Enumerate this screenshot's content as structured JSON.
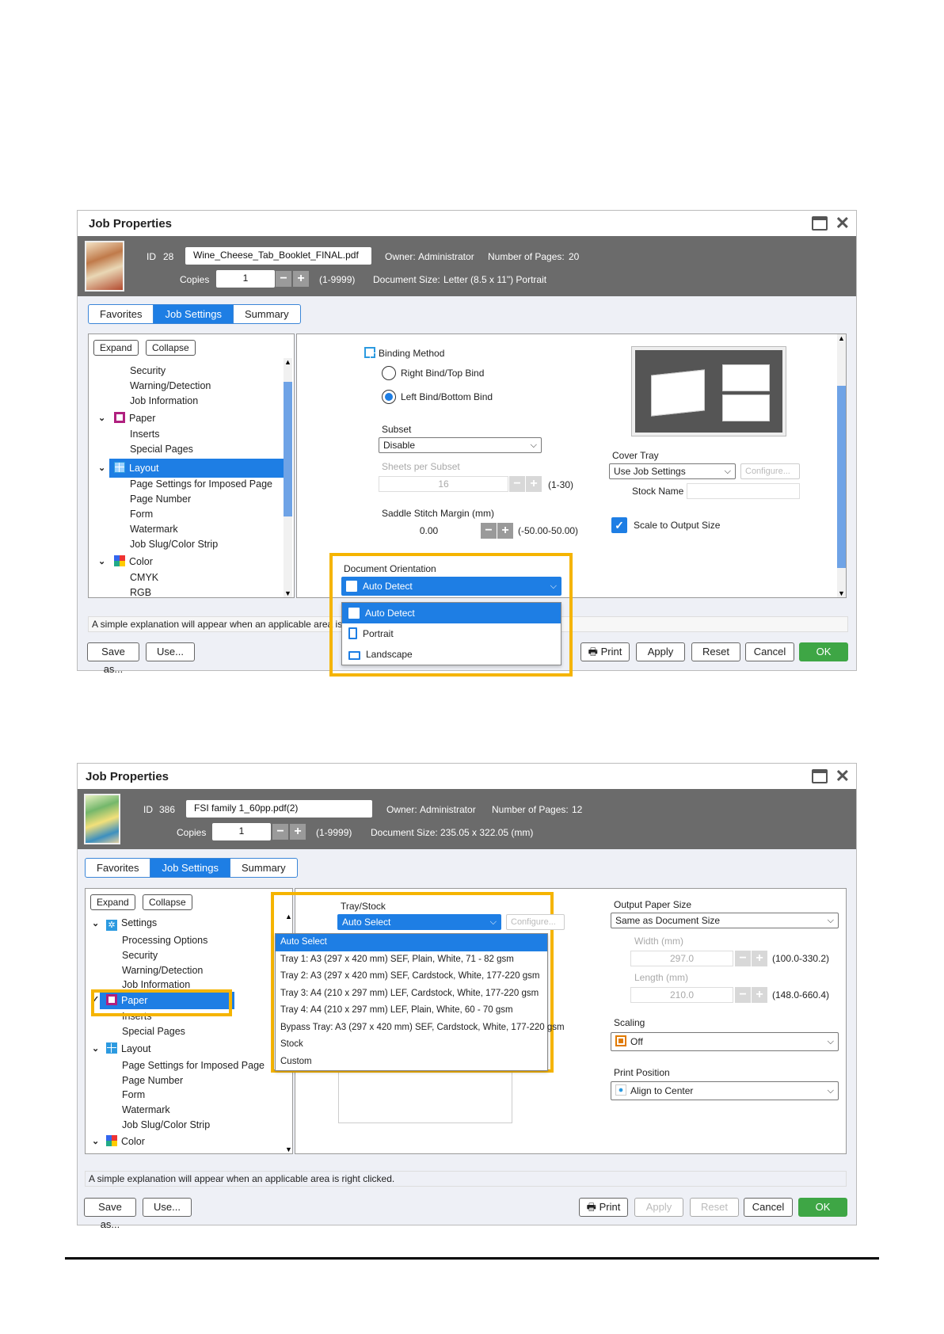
{
  "dialog1": {
    "title": "Job Properties",
    "header": {
      "id_label": "ID",
      "id_value": "28",
      "filename": "Wine_Cheese_Tab_Booklet_FINAL.pdf",
      "owner_label": "Owner:",
      "owner_value": "Administrator",
      "pages_label": "Number of Pages:",
      "pages_value": "20",
      "copies_label": "Copies",
      "copies_value": "1",
      "copies_range": "(1-9999)",
      "docsize_label": "Document Size:",
      "docsize_value": "Letter (8.5 x 11\") Portrait"
    },
    "tabs": [
      "Favorites",
      "Job Settings",
      "Summary"
    ],
    "expand": "Expand",
    "collapse": "Collapse",
    "tree": [
      "Security",
      "Warning/Detection",
      "Job Information",
      "Paper",
      "Inserts",
      "Special Pages",
      "Layout",
      "Page Settings for Imposed Page",
      "Page Number",
      "Form",
      "Watermark",
      "Job Slug/Color Strip",
      "Color",
      "CMYK",
      "RGB"
    ],
    "binding_method": "Binding Method",
    "right_bind": "Right Bind/Top Bind",
    "left_bind": "Left Bind/Bottom Bind",
    "subset_label": "Subset",
    "subset_value": "Disable",
    "sheets_label": "Sheets per Subset",
    "sheets_value": "16",
    "sheets_range": "(1-30)",
    "saddle_label": "Saddle Stitch Margin (mm)",
    "saddle_value": "0.00",
    "saddle_range": "(-50.00-50.00)",
    "cover_tray_label": "Cover Tray",
    "cover_tray_value": "Use Job Settings",
    "configure": "Configure...",
    "stock_name": "Stock Name",
    "scale_label": "Scale to Output Size",
    "orientation_label": "Document Orientation",
    "orientation_value": "Auto Detect",
    "orientation_options": [
      "Auto Detect",
      "Portrait",
      "Landscape"
    ],
    "explain": "A simple explanation will appear when an applicable area is rig",
    "save_as": "Save as...",
    "use": "Use...",
    "print": "Print",
    "apply": "Apply",
    "reset": "Reset",
    "cancel": "Cancel",
    "ok": "OK"
  },
  "dialog2": {
    "title": "Job Properties",
    "header": {
      "id_label": "ID",
      "id_value": "386",
      "filename": "FSI family 1_60pp.pdf(2)",
      "owner_label": "Owner:",
      "owner_value": "Administrator",
      "pages_label": "Number of Pages:",
      "pages_value": "12",
      "copies_label": "Copies",
      "copies_value": "1",
      "copies_range": "(1-9999)",
      "docsize_label": "Document Size:",
      "docsize_value": "235.05 x 322.05 (mm)"
    },
    "tabs": [
      "Favorites",
      "Job Settings",
      "Summary"
    ],
    "expand": "Expand",
    "collapse": "Collapse",
    "tree": [
      "Settings",
      "Processing Options",
      "Security",
      "Warning/Detection",
      "Job Information",
      "Paper",
      "Inserts",
      "Special Pages",
      "Layout",
      "Page Settings for Imposed Page",
      "Page Number",
      "Form",
      "Watermark",
      "Job Slug/Color Strip",
      "Color"
    ],
    "tray_label": "Tray/Stock",
    "tray_value": "Auto Select",
    "configure": "Configure...",
    "tray_options": [
      "Auto Select",
      "Tray 1: A3 (297 x 420 mm) SEF, Plain, White, 71 - 82 gsm",
      "Tray 2: A3 (297 x 420 mm) SEF, Cardstock, White, 177-220 gsm",
      "Tray 3: A4 (210 x 297 mm) LEF, Cardstock, White, 177-220 gsm",
      "Tray 4: A4 (210 x 297 mm) LEF, Plain, White, 60 - 70 gsm",
      "Bypass Tray: A3 (297 x 420 mm) SEF, Cardstock, White, 177-220 gsm",
      "Stock",
      "Custom"
    ],
    "output_label": "Output Paper Size",
    "output_value": "Same as Document Size",
    "width_label": "Width (mm)",
    "width_value": "297.0",
    "width_range": "(100.0-330.2)",
    "length_label": "Length (mm)",
    "length_value": "210.0",
    "length_range": "(148.0-660.4)",
    "scaling_label": "Scaling",
    "scaling_value": "Off",
    "position_label": "Print Position",
    "position_value": "Align to Center",
    "explain": "A simple explanation will appear when an applicable area is right clicked.",
    "save_as": "Save as...",
    "use": "Use...",
    "print": "Print",
    "apply": "Apply",
    "reset": "Reset",
    "cancel": "Cancel",
    "ok": "OK"
  },
  "colors": {
    "accent": "#1e7ee4",
    "highlight": "#f5b400",
    "ok": "#3ea645",
    "header": "#6b6b6b"
  }
}
